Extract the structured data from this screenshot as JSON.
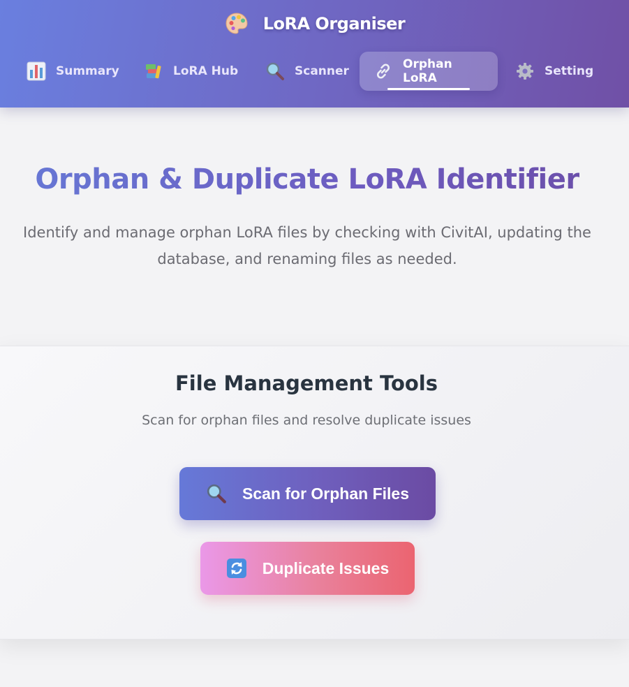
{
  "header": {
    "brand_icon": "palette-icon",
    "title": "LoRA Organiser"
  },
  "nav": {
    "items": [
      {
        "label": "Summary",
        "icon": "bar-chart-icon",
        "active": false
      },
      {
        "label": "LoRA Hub",
        "icon": "books-icon",
        "active": false
      },
      {
        "label": "Scanner",
        "icon": "magnifier-icon",
        "active": false
      },
      {
        "label": "Orphan LoRA",
        "icon": "link-icon",
        "active": true
      },
      {
        "label": "Setting",
        "icon": "gear-icon",
        "active": false
      }
    ]
  },
  "hero": {
    "title": "Orphan & Duplicate LoRA Identifier",
    "description": "Identify and manage orphan LoRA files by checking with CivitAI, updating the database, and renaming files as needed."
  },
  "tools": {
    "title": "File Management Tools",
    "subtitle": "Scan for orphan files and resolve duplicate issues",
    "scan_button": {
      "label": "Scan for Orphan Files",
      "icon": "magnifier-icon"
    },
    "duplicate_button": {
      "label": "Duplicate Issues",
      "icon": "refresh-icon"
    }
  },
  "colors": {
    "header_gradient_start": "#6a7fdf",
    "header_gradient_end": "#7050a6",
    "scan_button_start": "#6679d8",
    "scan_button_end": "#6b4ba3",
    "duplicate_button_start": "#ea98e8",
    "duplicate_button_end": "#eb6470"
  }
}
